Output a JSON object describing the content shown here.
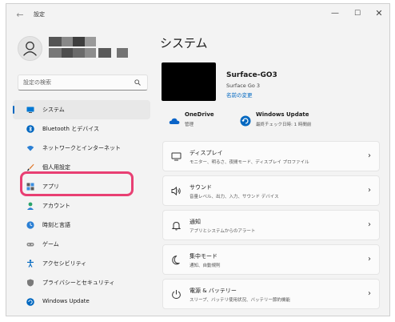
{
  "window": {
    "title": "設定",
    "back_glyph": "←",
    "min_glyph": "—",
    "max_glyph": "☐",
    "close_glyph": "✕"
  },
  "search": {
    "placeholder": "設定の検索"
  },
  "nav": {
    "items": [
      {
        "label": "システム",
        "icon": "system-icon",
        "active": true
      },
      {
        "label": "Bluetooth とデバイス",
        "icon": "bluetooth-icon"
      },
      {
        "label": "ネットワークとインターネット",
        "icon": "wifi-icon"
      },
      {
        "label": "個人用設定",
        "icon": "personalization-brush-icon"
      },
      {
        "label": "アプリ",
        "icon": "apps-icon",
        "highlighted": true
      },
      {
        "label": "アカウント",
        "icon": "account-icon"
      },
      {
        "label": "時刻と言語",
        "icon": "time-language-icon"
      },
      {
        "label": "ゲーム",
        "icon": "gaming-icon"
      },
      {
        "label": "アクセシビリティ",
        "icon": "accessibility-icon"
      },
      {
        "label": "プライバシーとセキュリティ",
        "icon": "shield-icon"
      },
      {
        "label": "Windows Update",
        "icon": "windows-update-icon"
      }
    ],
    "highlight_color": "#e83f73"
  },
  "main": {
    "title": "システム",
    "device": {
      "name": "Surface-GO3",
      "model": "Surface Go 3",
      "rename": "名前の変更"
    },
    "onedrive": {
      "title": "OneDrive",
      "sub": "管理"
    },
    "windows_update": {
      "title": "Windows Update",
      "sub": "最終チェック日時: 1 時間前"
    },
    "cards": [
      {
        "title": "ディスプレイ",
        "sub": "モニター、明るさ、夜間モード、ディスプレイ プロファイル",
        "icon": "display-icon"
      },
      {
        "title": "サウンド",
        "sub": "音量レベル、出力、入力、サウンド デバイス",
        "icon": "speaker-icon"
      },
      {
        "title": "通知",
        "sub": "アプリとシステムからのアラート",
        "icon": "bell-icon"
      },
      {
        "title": "集中モード",
        "sub": "通知、自動規則",
        "icon": "moon-icon"
      },
      {
        "title": "電源 & バッテリー",
        "sub": "スリープ、バッテリ使用状況、バッテリー節約機能",
        "icon": "power-icon"
      }
    ],
    "chevron": "›"
  },
  "colors": {
    "accent": "#0067c0",
    "window_bg": "#f3f3f3",
    "card_bg": "#fbfbfb"
  }
}
